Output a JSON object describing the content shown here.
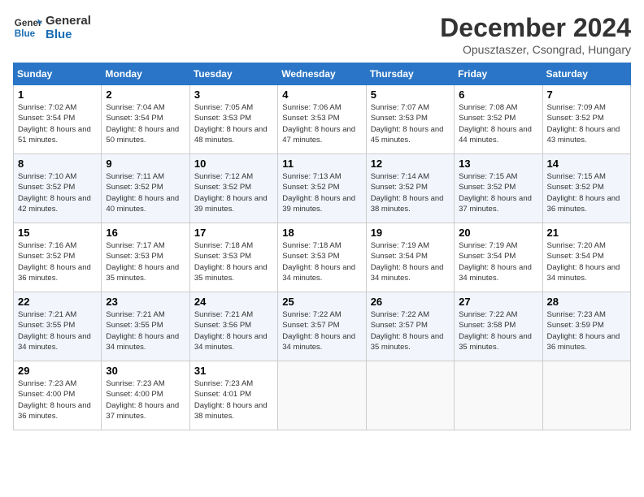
{
  "logo": {
    "line1": "General",
    "line2": "Blue"
  },
  "title": "December 2024",
  "location": "Opusztaszer, Csongrad, Hungary",
  "days_header": [
    "Sunday",
    "Monday",
    "Tuesday",
    "Wednesday",
    "Thursday",
    "Friday",
    "Saturday"
  ],
  "weeks": [
    [
      {
        "day": "1",
        "sunrise": "Sunrise: 7:02 AM",
        "sunset": "Sunset: 3:54 PM",
        "daylight": "Daylight: 8 hours and 51 minutes."
      },
      {
        "day": "2",
        "sunrise": "Sunrise: 7:04 AM",
        "sunset": "Sunset: 3:54 PM",
        "daylight": "Daylight: 8 hours and 50 minutes."
      },
      {
        "day": "3",
        "sunrise": "Sunrise: 7:05 AM",
        "sunset": "Sunset: 3:53 PM",
        "daylight": "Daylight: 8 hours and 48 minutes."
      },
      {
        "day": "4",
        "sunrise": "Sunrise: 7:06 AM",
        "sunset": "Sunset: 3:53 PM",
        "daylight": "Daylight: 8 hours and 47 minutes."
      },
      {
        "day": "5",
        "sunrise": "Sunrise: 7:07 AM",
        "sunset": "Sunset: 3:53 PM",
        "daylight": "Daylight: 8 hours and 45 minutes."
      },
      {
        "day": "6",
        "sunrise": "Sunrise: 7:08 AM",
        "sunset": "Sunset: 3:52 PM",
        "daylight": "Daylight: 8 hours and 44 minutes."
      },
      {
        "day": "7",
        "sunrise": "Sunrise: 7:09 AM",
        "sunset": "Sunset: 3:52 PM",
        "daylight": "Daylight: 8 hours and 43 minutes."
      }
    ],
    [
      {
        "day": "8",
        "sunrise": "Sunrise: 7:10 AM",
        "sunset": "Sunset: 3:52 PM",
        "daylight": "Daylight: 8 hours and 42 minutes."
      },
      {
        "day": "9",
        "sunrise": "Sunrise: 7:11 AM",
        "sunset": "Sunset: 3:52 PM",
        "daylight": "Daylight: 8 hours and 40 minutes."
      },
      {
        "day": "10",
        "sunrise": "Sunrise: 7:12 AM",
        "sunset": "Sunset: 3:52 PM",
        "daylight": "Daylight: 8 hours and 39 minutes."
      },
      {
        "day": "11",
        "sunrise": "Sunrise: 7:13 AM",
        "sunset": "Sunset: 3:52 PM",
        "daylight": "Daylight: 8 hours and 39 minutes."
      },
      {
        "day": "12",
        "sunrise": "Sunrise: 7:14 AM",
        "sunset": "Sunset: 3:52 PM",
        "daylight": "Daylight: 8 hours and 38 minutes."
      },
      {
        "day": "13",
        "sunrise": "Sunrise: 7:15 AM",
        "sunset": "Sunset: 3:52 PM",
        "daylight": "Daylight: 8 hours and 37 minutes."
      },
      {
        "day": "14",
        "sunrise": "Sunrise: 7:15 AM",
        "sunset": "Sunset: 3:52 PM",
        "daylight": "Daylight: 8 hours and 36 minutes."
      }
    ],
    [
      {
        "day": "15",
        "sunrise": "Sunrise: 7:16 AM",
        "sunset": "Sunset: 3:52 PM",
        "daylight": "Daylight: 8 hours and 36 minutes."
      },
      {
        "day": "16",
        "sunrise": "Sunrise: 7:17 AM",
        "sunset": "Sunset: 3:53 PM",
        "daylight": "Daylight: 8 hours and 35 minutes."
      },
      {
        "day": "17",
        "sunrise": "Sunrise: 7:18 AM",
        "sunset": "Sunset: 3:53 PM",
        "daylight": "Daylight: 8 hours and 35 minutes."
      },
      {
        "day": "18",
        "sunrise": "Sunrise: 7:18 AM",
        "sunset": "Sunset: 3:53 PM",
        "daylight": "Daylight: 8 hours and 34 minutes."
      },
      {
        "day": "19",
        "sunrise": "Sunrise: 7:19 AM",
        "sunset": "Sunset: 3:54 PM",
        "daylight": "Daylight: 8 hours and 34 minutes."
      },
      {
        "day": "20",
        "sunrise": "Sunrise: 7:19 AM",
        "sunset": "Sunset: 3:54 PM",
        "daylight": "Daylight: 8 hours and 34 minutes."
      },
      {
        "day": "21",
        "sunrise": "Sunrise: 7:20 AM",
        "sunset": "Sunset: 3:54 PM",
        "daylight": "Daylight: 8 hours and 34 minutes."
      }
    ],
    [
      {
        "day": "22",
        "sunrise": "Sunrise: 7:21 AM",
        "sunset": "Sunset: 3:55 PM",
        "daylight": "Daylight: 8 hours and 34 minutes."
      },
      {
        "day": "23",
        "sunrise": "Sunrise: 7:21 AM",
        "sunset": "Sunset: 3:55 PM",
        "daylight": "Daylight: 8 hours and 34 minutes."
      },
      {
        "day": "24",
        "sunrise": "Sunrise: 7:21 AM",
        "sunset": "Sunset: 3:56 PM",
        "daylight": "Daylight: 8 hours and 34 minutes."
      },
      {
        "day": "25",
        "sunrise": "Sunrise: 7:22 AM",
        "sunset": "Sunset: 3:57 PM",
        "daylight": "Daylight: 8 hours and 34 minutes."
      },
      {
        "day": "26",
        "sunrise": "Sunrise: 7:22 AM",
        "sunset": "Sunset: 3:57 PM",
        "daylight": "Daylight: 8 hours and 35 minutes."
      },
      {
        "day": "27",
        "sunrise": "Sunrise: 7:22 AM",
        "sunset": "Sunset: 3:58 PM",
        "daylight": "Daylight: 8 hours and 35 minutes."
      },
      {
        "day": "28",
        "sunrise": "Sunrise: 7:23 AM",
        "sunset": "Sunset: 3:59 PM",
        "daylight": "Daylight: 8 hours and 36 minutes."
      }
    ],
    [
      {
        "day": "29",
        "sunrise": "Sunrise: 7:23 AM",
        "sunset": "Sunset: 4:00 PM",
        "daylight": "Daylight: 8 hours and 36 minutes."
      },
      {
        "day": "30",
        "sunrise": "Sunrise: 7:23 AM",
        "sunset": "Sunset: 4:00 PM",
        "daylight": "Daylight: 8 hours and 37 minutes."
      },
      {
        "day": "31",
        "sunrise": "Sunrise: 7:23 AM",
        "sunset": "Sunset: 4:01 PM",
        "daylight": "Daylight: 8 hours and 38 minutes."
      },
      {
        "day": "",
        "sunrise": "",
        "sunset": "",
        "daylight": ""
      },
      {
        "day": "",
        "sunrise": "",
        "sunset": "",
        "daylight": ""
      },
      {
        "day": "",
        "sunrise": "",
        "sunset": "",
        "daylight": ""
      },
      {
        "day": "",
        "sunrise": "",
        "sunset": "",
        "daylight": ""
      }
    ]
  ]
}
